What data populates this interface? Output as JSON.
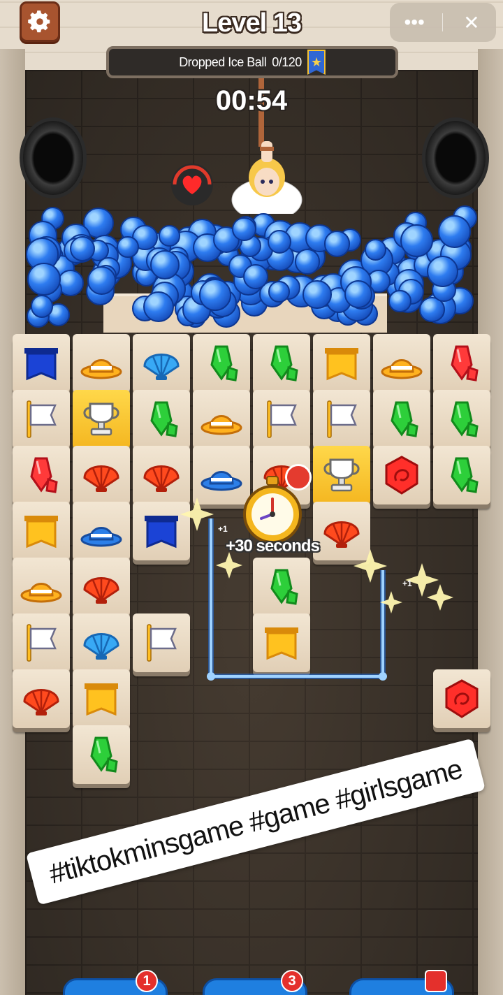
{
  "header": {
    "level_title": "Level 13",
    "settings_icon": "gear-icon",
    "menu_icon": "more-dots-icon",
    "close_icon": "close-icon",
    "more_glyph": "•••",
    "close_glyph": "✕"
  },
  "goal": {
    "label": "Dropped Ice Ball",
    "progress": "0/120",
    "badge_icon": "star-ribbon-icon"
  },
  "timer": "00:54",
  "bonus": {
    "text": "+30 seconds",
    "plus_one_a": "+1",
    "plus_one_b": "+1"
  },
  "board": {
    "rows": [
      [
        "banner-blue",
        "hat-orange",
        "shell-blue",
        "gem-green",
        "gem-green",
        "banner-yellow",
        "hat-orange",
        "gem-red"
      ],
      [
        "flag-white",
        "trophy-selected",
        "gem-green",
        "hat-orange",
        "flag-white",
        "flag-white",
        "gem-green",
        "gem-green"
      ],
      [
        "gem-red",
        "shell-red",
        "shell-red",
        "hat-blue",
        "shell-red",
        "trophy-selected",
        "gem-redhex",
        "gem-green"
      ],
      [
        "banner-yellow",
        "hat-blue",
        "banner-blue",
        "",
        "",
        "shell-red",
        "",
        ""
      ],
      [
        "hat-orange",
        "shell-red",
        "",
        "",
        "gem-green",
        "",
        "",
        ""
      ],
      [
        "flag-white",
        "shell-blue",
        "flag-white",
        "",
        "banner-yellow",
        "",
        "",
        ""
      ],
      [
        "shell-red",
        "banner-yellow",
        "",
        "",
        "",
        "",
        "",
        "gem-redhex"
      ],
      [
        "",
        "gem-green",
        "",
        "",
        "",
        "",
        "",
        ""
      ]
    ]
  },
  "overlay_caption": "#tiktokminsgame #game #girlsgame",
  "powerups": [
    {
      "name": "undo",
      "count": "1"
    },
    {
      "name": "hint",
      "count": "3"
    },
    {
      "name": "video-boost",
      "count": ""
    }
  ],
  "colors": {
    "accent_blue": "#1f7fe0",
    "tile": "#f2e6d3",
    "selected_tile": "#ffd84a",
    "line": "#3aa0ff"
  }
}
